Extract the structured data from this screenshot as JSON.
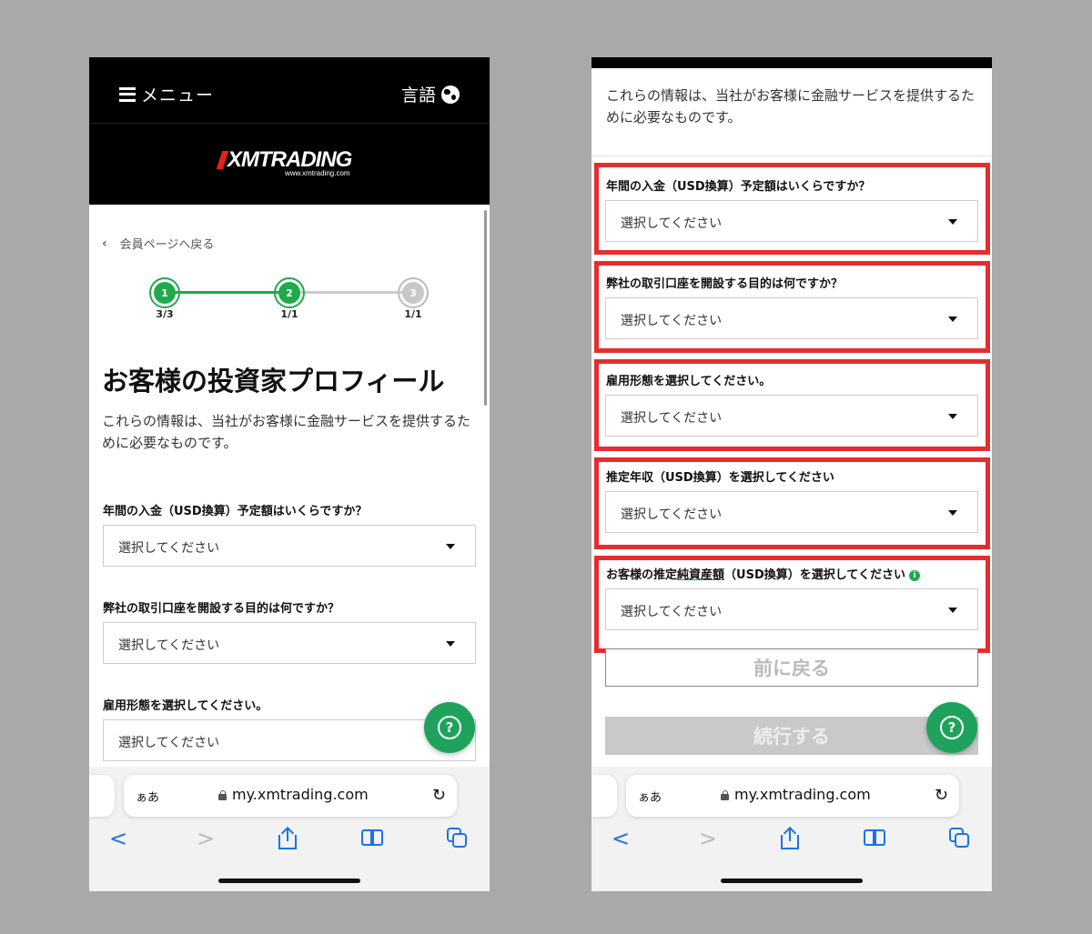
{
  "header": {
    "menu_label": "メニュー",
    "language_label": "言語"
  },
  "logo": {
    "brand": "XMTRADING",
    "url": "www.xmtrading.com"
  },
  "back_link": "会員ページへ戻る",
  "stepper": [
    {
      "number": "1",
      "sub": "3/3",
      "state": "done"
    },
    {
      "number": "2",
      "sub": "1/1",
      "state": "current"
    },
    {
      "number": "3",
      "sub": "1/1",
      "state": "pending"
    }
  ],
  "page_title": "お客様の投資家プロフィール",
  "intro": "これらの情報は、当社がお客様に金融サービスを提供するために必要なものです。",
  "questions": {
    "q1": "年間の入金（USD換算）予定額はいくらですか？",
    "q2": "弊社の取引口座を開設する目的は何ですか？",
    "q3": "雇用形態を選択してください。",
    "q4": "推定年収（USD換算）を選択してください",
    "q5_pre": "お客様の推定",
    "q5_link": "純資産額",
    "q5_post": "（USD換算）を選択してください"
  },
  "select_placeholder": "選択してください",
  "buttons": {
    "back": "前に戻る",
    "continue": "続行する",
    "help": "?"
  },
  "browser": {
    "aa": "ぁあ",
    "url": "my.xmtrading.com",
    "reload": "↻"
  },
  "colors": {
    "accent_green": "#1faa4b",
    "highlight_red": "#e52d2d",
    "ios_blue": "#1a73e8"
  }
}
